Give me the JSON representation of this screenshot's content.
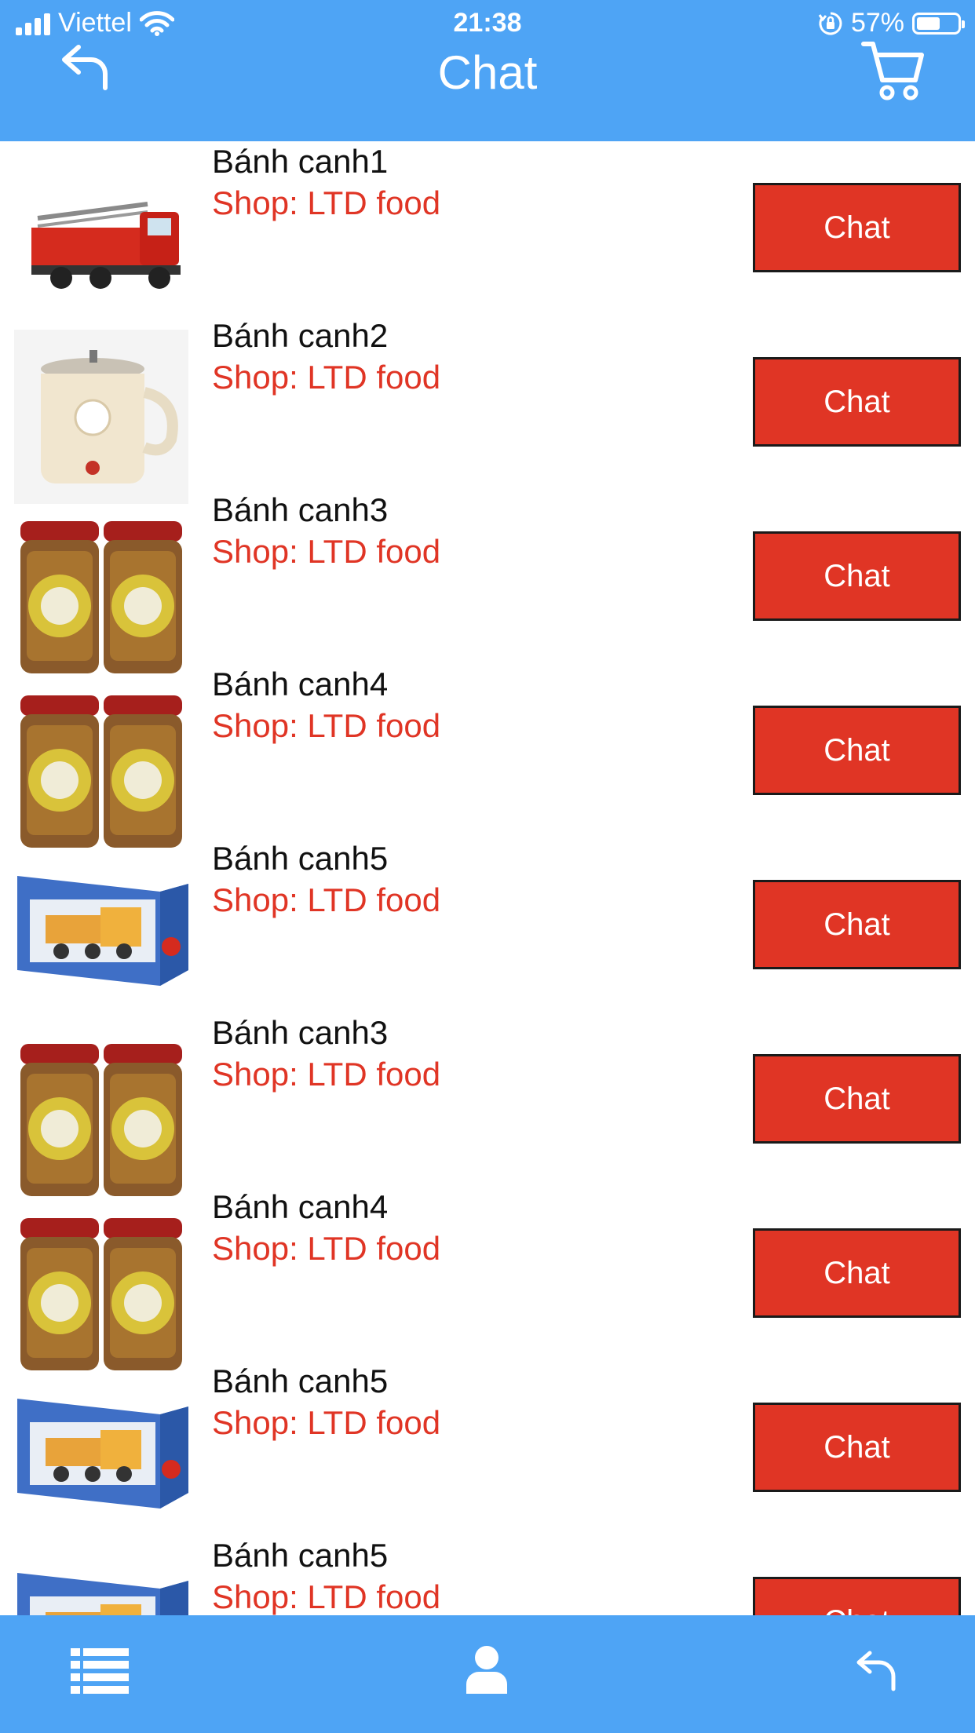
{
  "status_bar": {
    "carrier": "Viettel",
    "time": "21:38",
    "battery": "57%",
    "battery_level": 0.57
  },
  "header": {
    "title": "Chat",
    "back_icon": "back-arrow-icon",
    "cart_icon": "cart-icon"
  },
  "list": {
    "items": [
      {
        "name": "Bánh canh1",
        "shop": "Shop: LTD food",
        "button": "Chat",
        "thumb": "fire-truck"
      },
      {
        "name": "Bánh canh2",
        "shop": "Shop: LTD food",
        "button": "Chat",
        "thumb": "kettle"
      },
      {
        "name": "Bánh canh3",
        "shop": "Shop: LTD food",
        "button": "Chat",
        "thumb": "food-jars"
      },
      {
        "name": "Bánh canh4",
        "shop": "Shop: LTD food",
        "button": "Chat",
        "thumb": "food-jars"
      },
      {
        "name": "Bánh canh5",
        "shop": "Shop: LTD food",
        "button": "Chat",
        "thumb": "toy-box"
      },
      {
        "name": "Bánh canh3",
        "shop": "Shop: LTD food",
        "button": "Chat",
        "thumb": "food-jars"
      },
      {
        "name": "Bánh canh4",
        "shop": "Shop: LTD food",
        "button": "Chat",
        "thumb": "food-jars"
      },
      {
        "name": "Bánh canh5",
        "shop": "Shop: LTD food",
        "button": "Chat",
        "thumb": "toy-box"
      },
      {
        "name": "Bánh canh5",
        "shop": "Shop: LTD food",
        "button": "Chat",
        "thumb": "toy-box"
      }
    ]
  },
  "tab_bar": {
    "items": [
      "list-icon",
      "user-icon",
      "return-icon"
    ]
  },
  "colors": {
    "primary": "#4ea4f5",
    "accent": "#e03525",
    "text": "#111111"
  }
}
